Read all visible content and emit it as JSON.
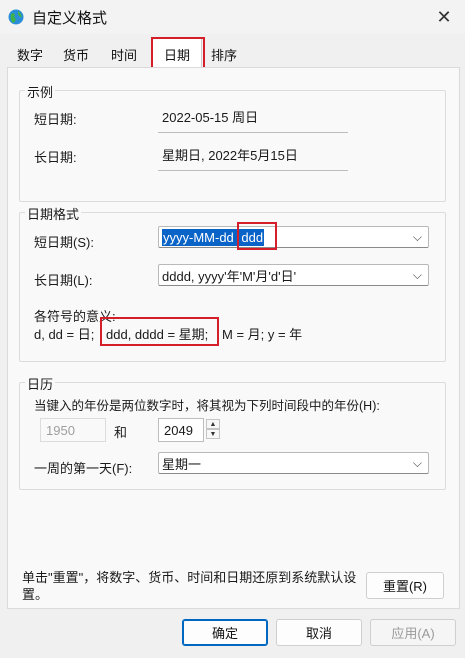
{
  "window": {
    "title": "自定义格式",
    "close_icon": "✕"
  },
  "tabs": [
    {
      "label": "数字"
    },
    {
      "label": "货币"
    },
    {
      "label": "时间"
    },
    {
      "label": "日期",
      "active": true
    },
    {
      "label": "排序"
    }
  ],
  "example": {
    "group_title": "示例",
    "short_label": "短日期:",
    "short_value": "2022-05-15 周日",
    "long_label": "长日期:",
    "long_value": "星期日, 2022年5月15日"
  },
  "date_format": {
    "group_title": "日期格式",
    "short_label": "短日期(S):",
    "short_value_selected": "yyyy-MM-dd",
    "short_value_space": " ",
    "short_value_tail": "ddd",
    "long_label": "长日期(L):",
    "long_value": "dddd, yyyy'年'M'月'd'日'",
    "symbols_title": "各符号的意义:",
    "symbols_part1": "d, dd = 日;",
    "symbols_part2": "ddd, dddd = 星期;",
    "symbols_part3": "M = 月;  y = 年"
  },
  "calendar": {
    "group_title": "日历",
    "two_digit_text": "当键入的年份是两位数字时，将其视为下列时间段中的年份(H):",
    "start_year": "1950",
    "and_label": "和",
    "end_year": "2049",
    "first_day_label": "一周的第一天(F):",
    "first_day_value": "星期一"
  },
  "reset": {
    "text": "单击\"重置\"，将数字、货币、时间和日期还原到系统默认设置。",
    "button": "重置(R)"
  },
  "footer": {
    "ok": "确定",
    "cancel": "取消",
    "apply": "应用(A)"
  },
  "colors": {
    "highlight": "#d41e2a",
    "selection": "#0a64c8",
    "accent": "#0067c0"
  }
}
